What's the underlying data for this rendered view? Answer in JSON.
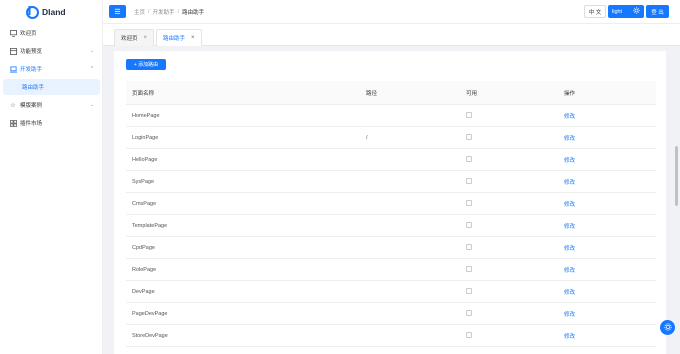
{
  "app": {
    "logo_text": "Dland"
  },
  "sidebar": {
    "items": [
      {
        "label": "欢迎页",
        "icon": "monitor-icon"
      },
      {
        "label": "功能预览",
        "icon": "layout-icon",
        "arrow": "⌄"
      },
      {
        "label": "开发助手",
        "icon": "laptop-icon",
        "arrow": "⌃"
      },
      {
        "label": "模版案例",
        "icon": "star-icon",
        "arrow": "⌄"
      },
      {
        "label": "插件市场",
        "icon": "grid-icon"
      }
    ],
    "sub_item": {
      "label": "路由助手"
    }
  },
  "header": {
    "toggle_icon": "☰",
    "breadcrumb": [
      "主页",
      "开发助手",
      "路由助手"
    ],
    "separator": "/",
    "lang_label": "中 文",
    "theme_label": "light",
    "logout_label": "登 出"
  },
  "tabs": [
    {
      "label": "欢迎页",
      "active": false
    },
    {
      "label": "路由助手",
      "active": true
    }
  ],
  "tab_close": "×",
  "toolbar": {
    "add_label": "+ 添加路由"
  },
  "table": {
    "columns": [
      "页面名称",
      "路径",
      "可用",
      "操作"
    ],
    "action_label": "修改",
    "rows": [
      {
        "name": "HomePage",
        "path": ""
      },
      {
        "name": "LoginPage",
        "path": "/"
      },
      {
        "name": "HelloPage",
        "path": ""
      },
      {
        "name": "SysPage",
        "path": ""
      },
      {
        "name": "CmsPage",
        "path": ""
      },
      {
        "name": "TemplatePage",
        "path": ""
      },
      {
        "name": "CpdPage",
        "path": ""
      },
      {
        "name": "RolePage",
        "path": ""
      },
      {
        "name": "DevPage",
        "path": ""
      },
      {
        "name": "PageDevPage",
        "path": ""
      },
      {
        "name": "StoreDevPage",
        "path": ""
      }
    ]
  },
  "colors": {
    "accent": "#1677ff",
    "submenu_bg": "#e8f3ff"
  }
}
